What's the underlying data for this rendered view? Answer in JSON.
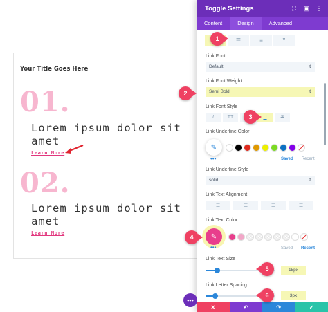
{
  "preview": {
    "title": "Your Title Goes Here",
    "items": [
      {
        "number": "01.",
        "text": "Lorem ipsum dolor sit amet",
        "link": "Learn More"
      },
      {
        "number": "02.",
        "text": "Lorem ipsum dolor sit amet",
        "link": "Learn More"
      }
    ]
  },
  "panel": {
    "title": "Toggle Settings",
    "tabs": [
      "Content",
      "Design",
      "Advanced"
    ],
    "active_tab": "Design",
    "fields": {
      "link_font": {
        "label": "Link Font",
        "value": "Default"
      },
      "link_font_weight": {
        "label": "Link Font Weight",
        "value": "Semi Bold"
      },
      "link_font_style": {
        "label": "Link Font Style"
      },
      "link_underline_color": {
        "label": "Link Underline Color"
      },
      "link_underline_style": {
        "label": "Link Underline Style",
        "value": "solid"
      },
      "link_text_alignment": {
        "label": "Link Text Alignment"
      },
      "link_text_color": {
        "label": "Link Text Color"
      },
      "link_text_size": {
        "label": "Link Text Size",
        "value": "15px",
        "fraction": 0.16
      },
      "link_letter_spacing": {
        "label": "Link Letter Spacing",
        "value": "3px",
        "fraction": 0.13
      }
    },
    "saved_label": "Saved",
    "recent_label": "Recent",
    "font_style_buttons": [
      "I",
      "TT",
      "Tт",
      "U",
      "S"
    ],
    "underline_swatches": [
      "#ffffff",
      "#000000",
      "#e02b20",
      "#e09900",
      "#edf000",
      "#7cda24",
      "#0c71c3",
      "#8300e9"
    ],
    "text_color_swatches": [
      "#e83e8c",
      "#f2a7c8",
      "checker",
      "checker",
      "checker",
      "checker",
      "checker",
      "#ffffff"
    ],
    "markers": [
      "1",
      "2",
      "3",
      "4",
      "5",
      "6"
    ]
  },
  "colors": {
    "header": "#6c2eb9",
    "tabs": "#7e3bd0",
    "accent": "#2b87da",
    "highlight": "#f6f7b5",
    "marker": "#ef4162",
    "pink": "#e83e8c"
  }
}
